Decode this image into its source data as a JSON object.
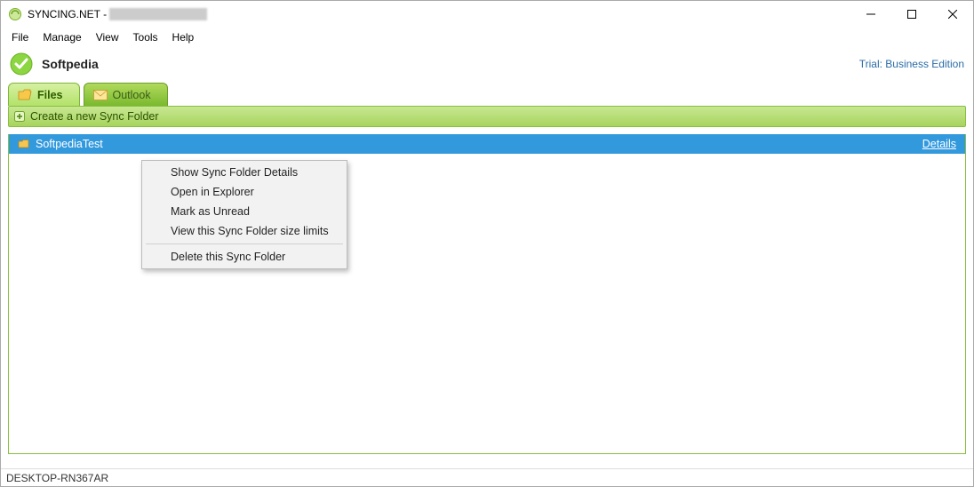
{
  "window": {
    "title_prefix": "SYNCING.NET - "
  },
  "menubar": {
    "items": [
      "File",
      "Manage",
      "View",
      "Tools",
      "Help"
    ]
  },
  "header": {
    "profile_name": "Softpedia",
    "trial_text": "Trial: Business Edition"
  },
  "tabs": {
    "files": "Files",
    "outlook": "Outlook"
  },
  "action_bar": {
    "create_label": "Create a new Sync Folder"
  },
  "list": {
    "items": [
      {
        "name": "SoftpediaTest",
        "details_link": "Details"
      }
    ]
  },
  "context_menu": {
    "items": [
      "Show Sync Folder Details",
      "Open in Explorer",
      "Mark as Unread",
      "View this Sync Folder size limits"
    ],
    "items2": [
      "Delete this Sync Folder"
    ]
  },
  "statusbar": {
    "text": "DESKTOP-RN367AR"
  }
}
